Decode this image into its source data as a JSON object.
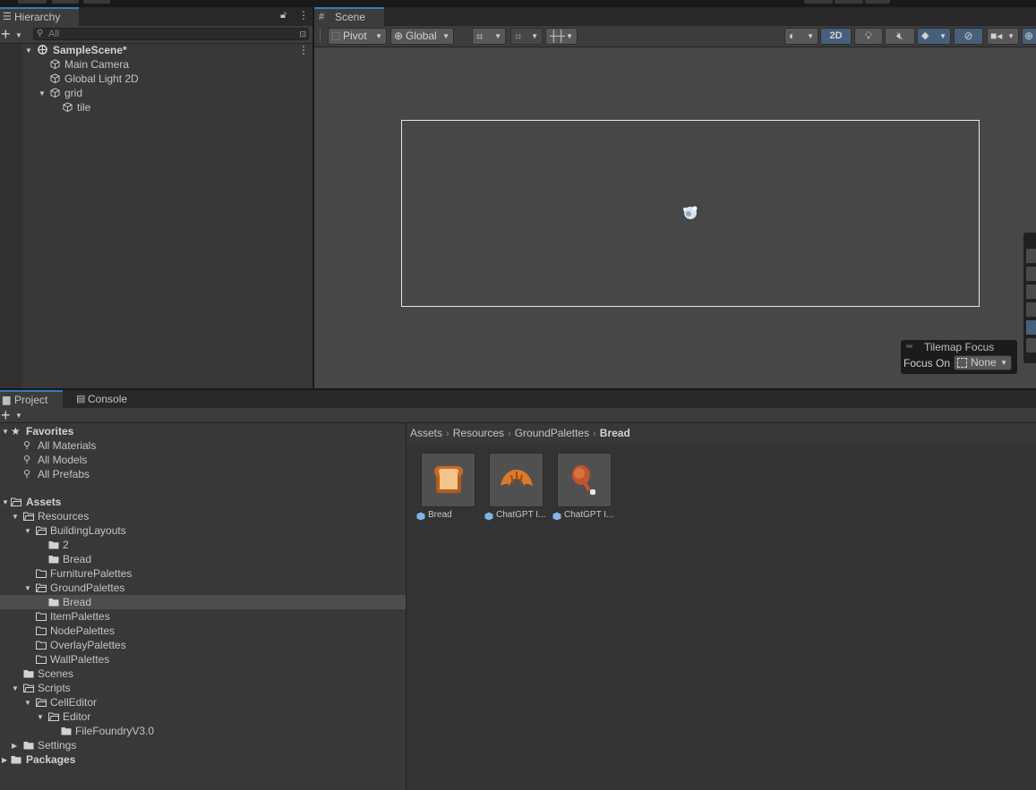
{
  "hierarchy": {
    "tab_label": "Hierarchy",
    "search_placeholder": "All",
    "items": [
      {
        "label": "SampleScene*",
        "bold": true
      },
      {
        "label": "Main Camera"
      },
      {
        "label": "Global Light 2D"
      },
      {
        "label": "grid"
      },
      {
        "label": "tile"
      }
    ]
  },
  "scene": {
    "tab_label": "Scene",
    "toolbar": {
      "pivot": "Pivot",
      "global": "Global",
      "mode_2d": "2D"
    },
    "tilemap_focus": {
      "title": "Tilemap Focus",
      "focus_on_label": "Focus On",
      "focus_value": "None"
    }
  },
  "project": {
    "tabs": [
      "Project",
      "Console"
    ],
    "tree": [
      {
        "label": "Favorites",
        "bold": true
      },
      {
        "label": "All Materials"
      },
      {
        "label": "All Models"
      },
      {
        "label": "All Prefabs"
      },
      {
        "label": "Assets",
        "bold": true
      },
      {
        "label": "Resources"
      },
      {
        "label": "BuildingLayouts"
      },
      {
        "label": "2"
      },
      {
        "label": "Bread"
      },
      {
        "label": "FurniturePalettes"
      },
      {
        "label": "GroundPalettes"
      },
      {
        "label": "Bread",
        "selected": true
      },
      {
        "label": "ItemPalettes"
      },
      {
        "label": "NodePalettes"
      },
      {
        "label": "OverlayPalettes"
      },
      {
        "label": "WallPalettes"
      },
      {
        "label": "Scenes"
      },
      {
        "label": "Scripts"
      },
      {
        "label": "CellEditor"
      },
      {
        "label": "Editor"
      },
      {
        "label": "FileFoundryV3.0"
      },
      {
        "label": "Settings"
      },
      {
        "label": "Packages",
        "bold": true
      }
    ],
    "breadcrumb": [
      "Assets",
      "Resources",
      "GroundPalettes",
      "Bread"
    ],
    "assets": [
      {
        "name": "Bread",
        "icon": "bread-slice-icon"
      },
      {
        "name": "ChatGPT I...",
        "icon": "croissant-icon"
      },
      {
        "name": "ChatGPT I...",
        "icon": "drumstick-icon"
      }
    ]
  },
  "colors": {
    "accent": "#3a79bb",
    "selected_row": "#4d4d4d",
    "toggle_blue": "#46607c"
  }
}
